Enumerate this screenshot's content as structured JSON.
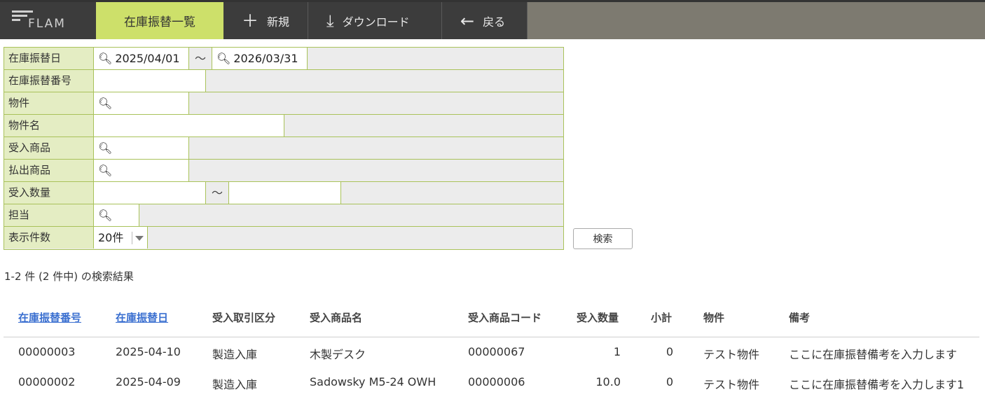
{
  "app": {
    "logo_text": "FLAM"
  },
  "toolbar": {
    "active_tab": "在庫振替一覧",
    "new_label": "新規",
    "download_label": "ダウンロード",
    "back_label": "戻る"
  },
  "form": {
    "date_label": "在庫振替日",
    "date_from": "2025/04/01",
    "date_to": "2026/03/31",
    "tilde": "〜",
    "number_label": "在庫振替番号",
    "property_label": "物件",
    "property_name_label": "物件名",
    "in_product_label": "受入商品",
    "out_product_label": "払出商品",
    "in_qty_label": "受入数量",
    "staff_label": "担当",
    "page_size_label": "表示件数",
    "page_size_value": "20件",
    "search_button": "検索"
  },
  "result_summary": "1-2 件 (2 件中) の検索結果",
  "table": {
    "headers": [
      "在庫振替番号",
      "在庫振替日",
      "受入取引区分",
      "受入商品名",
      "受入商品コード",
      "受入数量",
      "小計",
      "物件",
      "備考"
    ],
    "rows": [
      [
        "00000003",
        "2025-04-10",
        "製造入庫",
        "木製デスク",
        "00000067",
        "1",
        "0",
        "テスト物件",
        "ここに在庫振替備考を入力します"
      ],
      [
        "00000002",
        "2025-04-09",
        "製造入庫",
        "Sadowsky M5-24 OWH",
        "00000006",
        "10.0",
        "0",
        "テスト物件",
        "ここに在庫振替備考を入力します1"
      ]
    ]
  },
  "colors": {
    "accent": "#cde06a",
    "header_bg": "#3c3c3c",
    "link": "#3a6fd0",
    "label_bg": "#e4edc3"
  }
}
